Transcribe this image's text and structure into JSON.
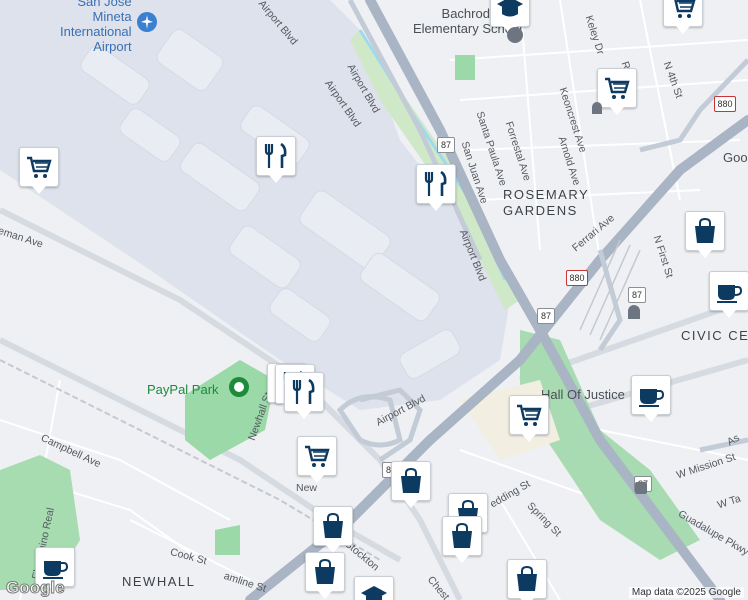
{
  "map": {
    "attribution": "Map data ©2025 Google",
    "logo": "Google",
    "colors": {
      "background": "#eef0f3",
      "airport": "#dde2ec",
      "park": "#9bd9a8",
      "freeway": "#a9b4c4",
      "pin_icon": "#0d3a60"
    },
    "areas": {
      "rosemary_gardens": "ROSEMARY\nGARDENS",
      "civic_center": "CIVIC CEN",
      "newhall": "NEWHALL"
    },
    "pois": {
      "airport": "San Jose\nMineta\nInternational\nAirport",
      "school": "Bachrodt\nElementary School",
      "paypal_park": "PayPal Park",
      "hall_of_justice": "Hall Of Justice",
      "goog": "Goog"
    },
    "streets": {
      "airport_blvd_1": "Airport Blvd",
      "airport_blvd_2": "Airport Blvd",
      "airport_blvd_3": "Airport Blvd",
      "airport_blvd_4": "Airport Blvd",
      "airport_blvd_5": "Airport Blvd",
      "coleman_ave": "leman Ave",
      "n_4th_st": "N 4th St",
      "n_first_st": "N First St",
      "keley_dr": "Keley Dr",
      "keoncrest_ave": "Keoncrest Ave",
      "forrestal_ave": "Forrestal Ave",
      "santa_paula_ave": "Santa Paula Ave",
      "san_juan_ave": "San Juan Ave",
      "arnold_ave": "Arnold Ave",
      "ferrari_ave": "Ferrari Ave",
      "campbell_ave": "Campbell Ave",
      "el_camino_real": "El Camino Real",
      "cook_st": "Cook St",
      "hamline_st": "amline St",
      "stockton": "Stockton",
      "spring_st": "Spring St",
      "hedding_st": "edding St",
      "w_mission_st": "W Mission St",
      "guadalupe_pkwy": "Guadalupe Pkwy",
      "w_ta": "W Ta",
      "newhall_st": "Newhall St",
      "new": "New",
      "chest": "Chest",
      "rd": "Rd",
      "as": "As"
    },
    "shields": [
      "87",
      "87",
      "87",
      "87",
      "87",
      "880",
      "880",
      "880"
    ],
    "markers": [
      {
        "icon": "grocery-cart-icon"
      },
      {
        "icon": "grocery-cart-icon"
      },
      {
        "icon": "grocery-cart-icon"
      },
      {
        "icon": "grocery-cart-icon"
      },
      {
        "icon": "grocery-cart-icon"
      },
      {
        "icon": "grocery-cart-icon"
      },
      {
        "icon": "restaurant-icon"
      },
      {
        "icon": "restaurant-icon"
      },
      {
        "icon": "restaurant-icon"
      },
      {
        "icon": "restaurant-icon"
      },
      {
        "icon": "shopping-bag-icon"
      },
      {
        "icon": "shopping-bag-icon"
      },
      {
        "icon": "shopping-bag-icon"
      },
      {
        "icon": "shopping-bag-icon"
      },
      {
        "icon": "shopping-bag-icon"
      },
      {
        "icon": "shopping-bag-icon"
      },
      {
        "icon": "shopping-bag-icon"
      },
      {
        "icon": "coffee-cup-icon"
      },
      {
        "icon": "coffee-cup-icon"
      },
      {
        "icon": "coffee-cup-icon"
      },
      {
        "icon": "school-icon"
      },
      {
        "icon": "school-icon"
      }
    ]
  }
}
